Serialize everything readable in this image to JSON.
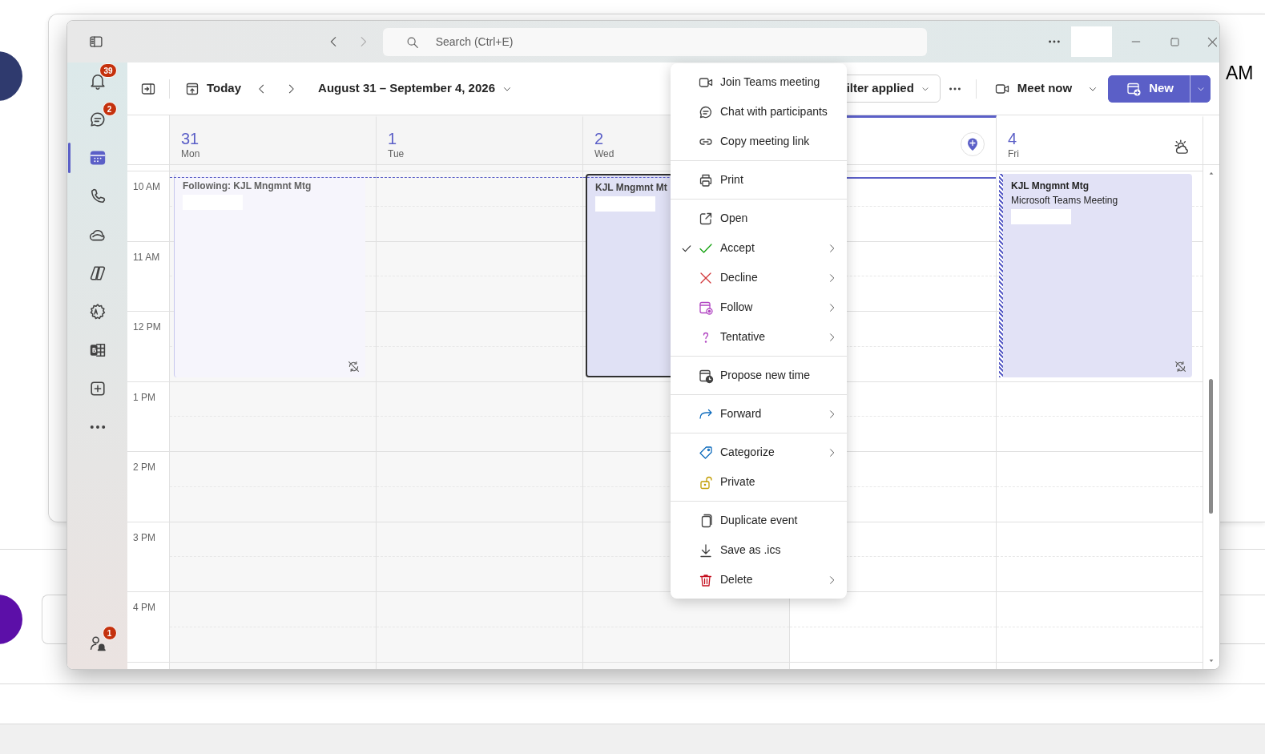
{
  "background": {
    "time_fragment": "AM"
  },
  "window": {
    "search": {
      "placeholder": "Search (Ctrl+E)"
    }
  },
  "rail": {
    "items": [
      {
        "kind": "bell",
        "badge": "39",
        "selected": false
      },
      {
        "kind": "chat",
        "badge": "2",
        "selected": false
      },
      {
        "kind": "calendar",
        "selected": true
      },
      {
        "kind": "phone",
        "selected": false
      },
      {
        "kind": "cloud",
        "selected": false
      },
      {
        "kind": "copilot",
        "selected": false
      },
      {
        "kind": "apps-gear",
        "selected": false
      },
      {
        "kind": "grid",
        "selected": false
      },
      {
        "kind": "add",
        "selected": false
      },
      {
        "kind": "more",
        "selected": false
      }
    ],
    "bottom": {
      "kind": "person-bell",
      "badge": "1"
    }
  },
  "toolbar": {
    "today": "Today",
    "date_range": "August 31 – September 4, 2026",
    "filter": "ilter applied",
    "meet_now": "Meet now",
    "new": "New"
  },
  "calendar": {
    "hours": [
      "10 AM",
      "11 AM",
      "12 PM",
      "1 PM",
      "2 PM",
      "3 PM",
      "4 PM"
    ],
    "days": [
      {
        "number": "31",
        "weekday": "Mon",
        "today": false,
        "events": [
          {
            "kind": "following",
            "title": "Following: KJL Mngmnt Mtg"
          }
        ]
      },
      {
        "number": "1",
        "weekday": "Tue",
        "today": false
      },
      {
        "number": "2",
        "weekday": "Wed",
        "today": false,
        "events": [
          {
            "kind": "selected",
            "title": "KJL Mngmnt Mt"
          }
        ]
      },
      {
        "today": true
      },
      {
        "number": "4",
        "weekday": "Fri",
        "today": false,
        "events": [
          {
            "kind": "tentative",
            "title": "KJL Mngmnt Mtg",
            "subtitle": "Microsoft Teams Meeting"
          }
        ]
      }
    ]
  },
  "context_menu": {
    "groups": [
      [
        {
          "label": "Join Teams meeting",
          "checked": false,
          "submenu": false
        },
        {
          "label": "Chat with participants",
          "checked": false,
          "submenu": false
        },
        {
          "label": "Copy meeting link",
          "checked": false,
          "submenu": false
        }
      ],
      [
        {
          "label": "Print",
          "checked": false,
          "submenu": false
        }
      ],
      [
        {
          "label": "Open",
          "checked": false,
          "submenu": false
        },
        {
          "label": "Accept",
          "checked": true,
          "submenu": true
        },
        {
          "label": "Decline",
          "checked": false,
          "submenu": true
        },
        {
          "label": "Follow",
          "checked": false,
          "submenu": true
        },
        {
          "label": "Tentative",
          "checked": false,
          "submenu": true
        }
      ],
      [
        {
          "label": "Propose new time",
          "checked": false,
          "submenu": false
        }
      ],
      [
        {
          "label": "Forward",
          "checked": false,
          "submenu": true
        }
      ],
      [
        {
          "label": "Categorize",
          "checked": false,
          "submenu": true
        },
        {
          "label": "Private",
          "checked": false,
          "submenu": false
        }
      ],
      [
        {
          "label": "Duplicate event",
          "checked": false,
          "submenu": false
        },
        {
          "label": "Save as .ics",
          "checked": false,
          "submenu": false
        },
        {
          "label": "Delete",
          "checked": false,
          "submenu": true
        }
      ]
    ]
  }
}
